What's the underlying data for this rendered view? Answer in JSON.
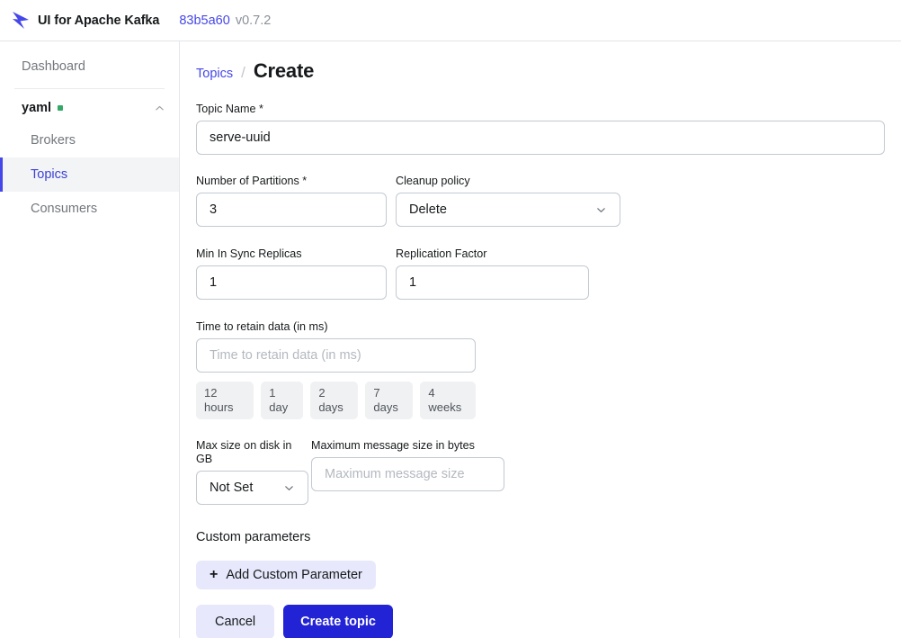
{
  "topbar": {
    "logo_icon": "kafka-arrow-logo",
    "brand": "UI for Apache Kafka",
    "commit": "83b5a60",
    "version": "v0.7.2"
  },
  "sidebar": {
    "dashboard_label": "Dashboard",
    "cluster": {
      "name": "yaml",
      "status_color": "#33a867",
      "collapse_icon": "chevron-up-icon"
    },
    "items": [
      {
        "label": "Brokers",
        "active": false
      },
      {
        "label": "Topics",
        "active": true
      },
      {
        "label": "Consumers",
        "active": false
      }
    ]
  },
  "breadcrumb": {
    "parent": "Topics",
    "separator": "/",
    "current": "Create"
  },
  "form": {
    "topic_name": {
      "label": "Topic Name *",
      "value": "serve-uuid",
      "placeholder": ""
    },
    "partitions": {
      "label": "Number of Partitions *",
      "value": "3",
      "placeholder": ""
    },
    "cleanup_policy": {
      "label": "Cleanup policy",
      "value": "Delete",
      "chevron_icon": "chevron-down-icon"
    },
    "min_insync_replicas": {
      "label": "Min In Sync Replicas",
      "value": "1",
      "placeholder": ""
    },
    "replication_factor": {
      "label": "Replication Factor",
      "value": "1",
      "placeholder": ""
    },
    "retention": {
      "label": "Time to retain data (in ms)",
      "value": "",
      "placeholder": "Time to retain data (in ms)",
      "presets": [
        "12 hours",
        "1 day",
        "2 days",
        "7 days",
        "4 weeks"
      ]
    },
    "max_size_on_disk": {
      "label": "Max size on disk in GB",
      "value": "Not Set",
      "chevron_icon": "chevron-down-icon"
    },
    "max_message_size": {
      "label": "Maximum message size in bytes",
      "value": "",
      "placeholder": "Maximum message size"
    },
    "custom_parameters": {
      "title": "Custom parameters",
      "add_label": "Add Custom Parameter",
      "add_icon": "plus-icon"
    },
    "actions": {
      "cancel_label": "Cancel",
      "submit_label": "Create topic",
      "submit_color": "#2323d6"
    }
  }
}
